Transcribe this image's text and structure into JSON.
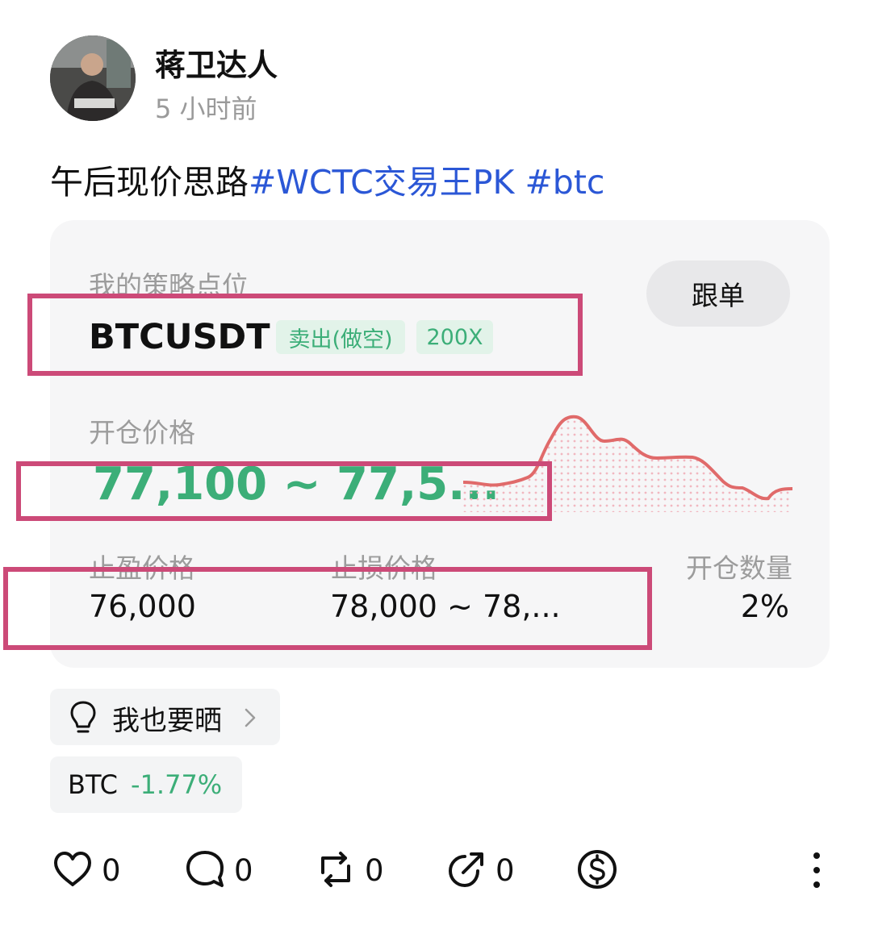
{
  "author": {
    "name": "蒋卫达人",
    "time": "5 小时前"
  },
  "post": {
    "text": "午后现价思路",
    "tag1": "#WCTC交易王PK",
    "tag2": "#btc"
  },
  "strategy": {
    "label": "我的策略点位",
    "follow_label": "跟单",
    "pair": "BTCUSDT",
    "side": "卖出(做空)",
    "leverage": "200X",
    "open_label": "开仓价格",
    "open_price": "77,100 ~ 77,5...",
    "tp_label": "止盈价格",
    "tp_value": "76,000",
    "sl_label": "止损价格",
    "sl_value": "78,000 ~ 78,...",
    "qty_label": "开仓数量",
    "qty_value": "2%"
  },
  "share": {
    "label": "我也要晒"
  },
  "ticker": {
    "symbol": "BTC",
    "change": "-1.77%"
  },
  "actions": {
    "like": "0",
    "comment": "0",
    "repost": "0",
    "share": "0"
  },
  "icons": {
    "like": "heart-icon",
    "comment": "comment-icon",
    "repost": "repost-icon",
    "share": "share-icon",
    "tip": "dollar-coin-icon",
    "more": "more-vertical-icon",
    "bulb": "lightbulb-icon",
    "chevron": "chevron-right-icon"
  },
  "colors": {
    "accent_green": "#3cae78",
    "hashtag_blue": "#2b57d6",
    "chart_red": "#e06a6a",
    "annotation": "#cc4a78"
  }
}
